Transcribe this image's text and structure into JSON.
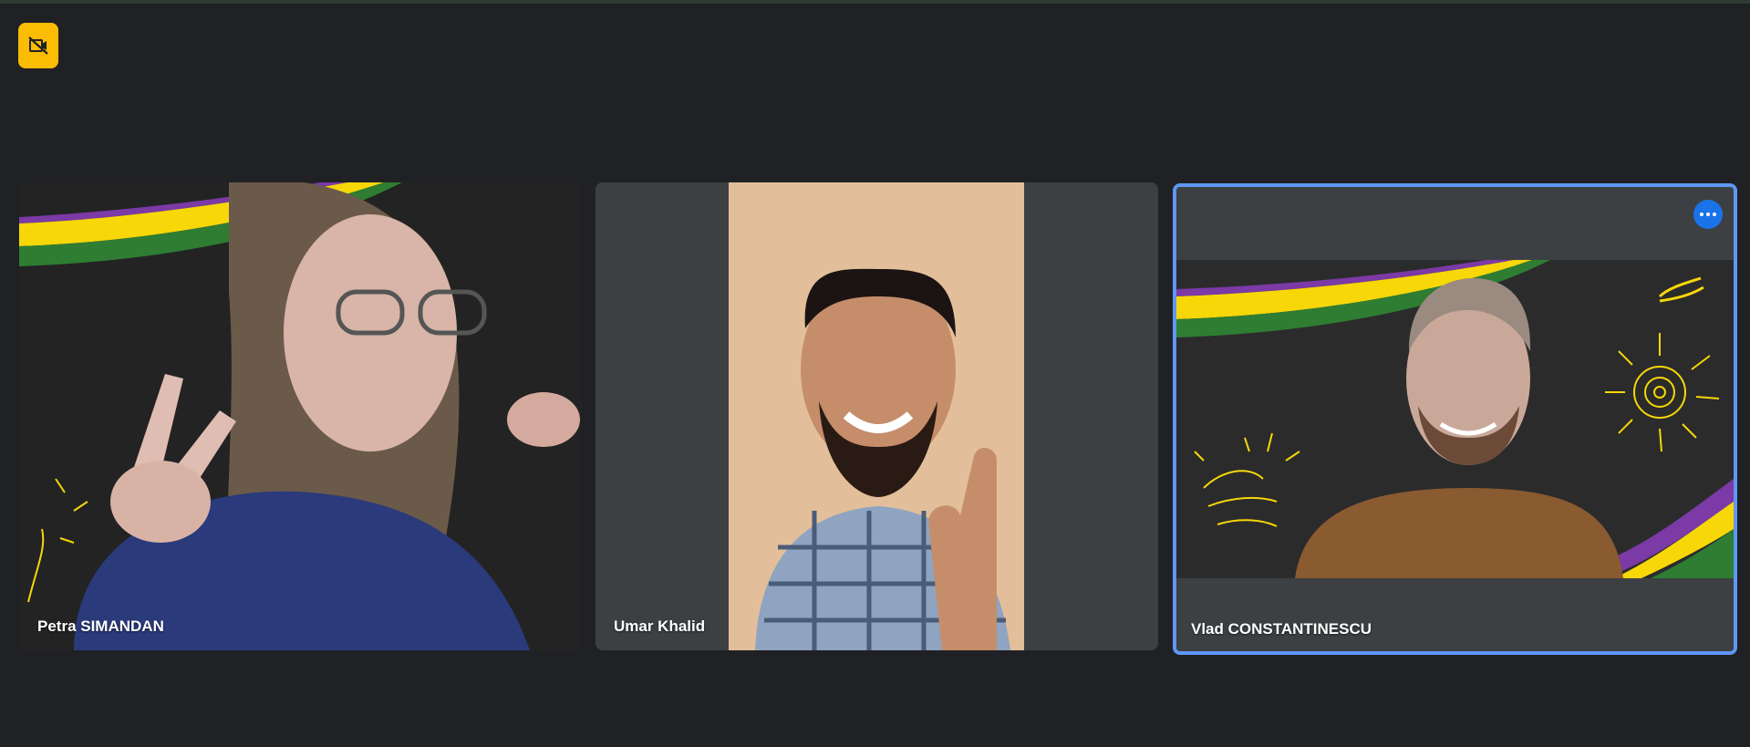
{
  "toolbar": {
    "notice_icon": "camera-off-icon",
    "accent": "#fbbc04"
  },
  "participants": [
    {
      "name": "Petra SIMANDAN",
      "active": false
    },
    {
      "name": "Umar Khalid",
      "active": false
    },
    {
      "name": "Vlad CONSTANTINESCU",
      "active": true,
      "more_icon": "more-options-icon"
    }
  ],
  "colors": {
    "background": "#202124",
    "tile": "#3c4043",
    "active_border": "#5e97f6",
    "more_button": "#1a73e8",
    "stripe_purple": "#7b3aa5",
    "stripe_yellow": "#f7d708",
    "stripe_green": "#2e7d32"
  }
}
